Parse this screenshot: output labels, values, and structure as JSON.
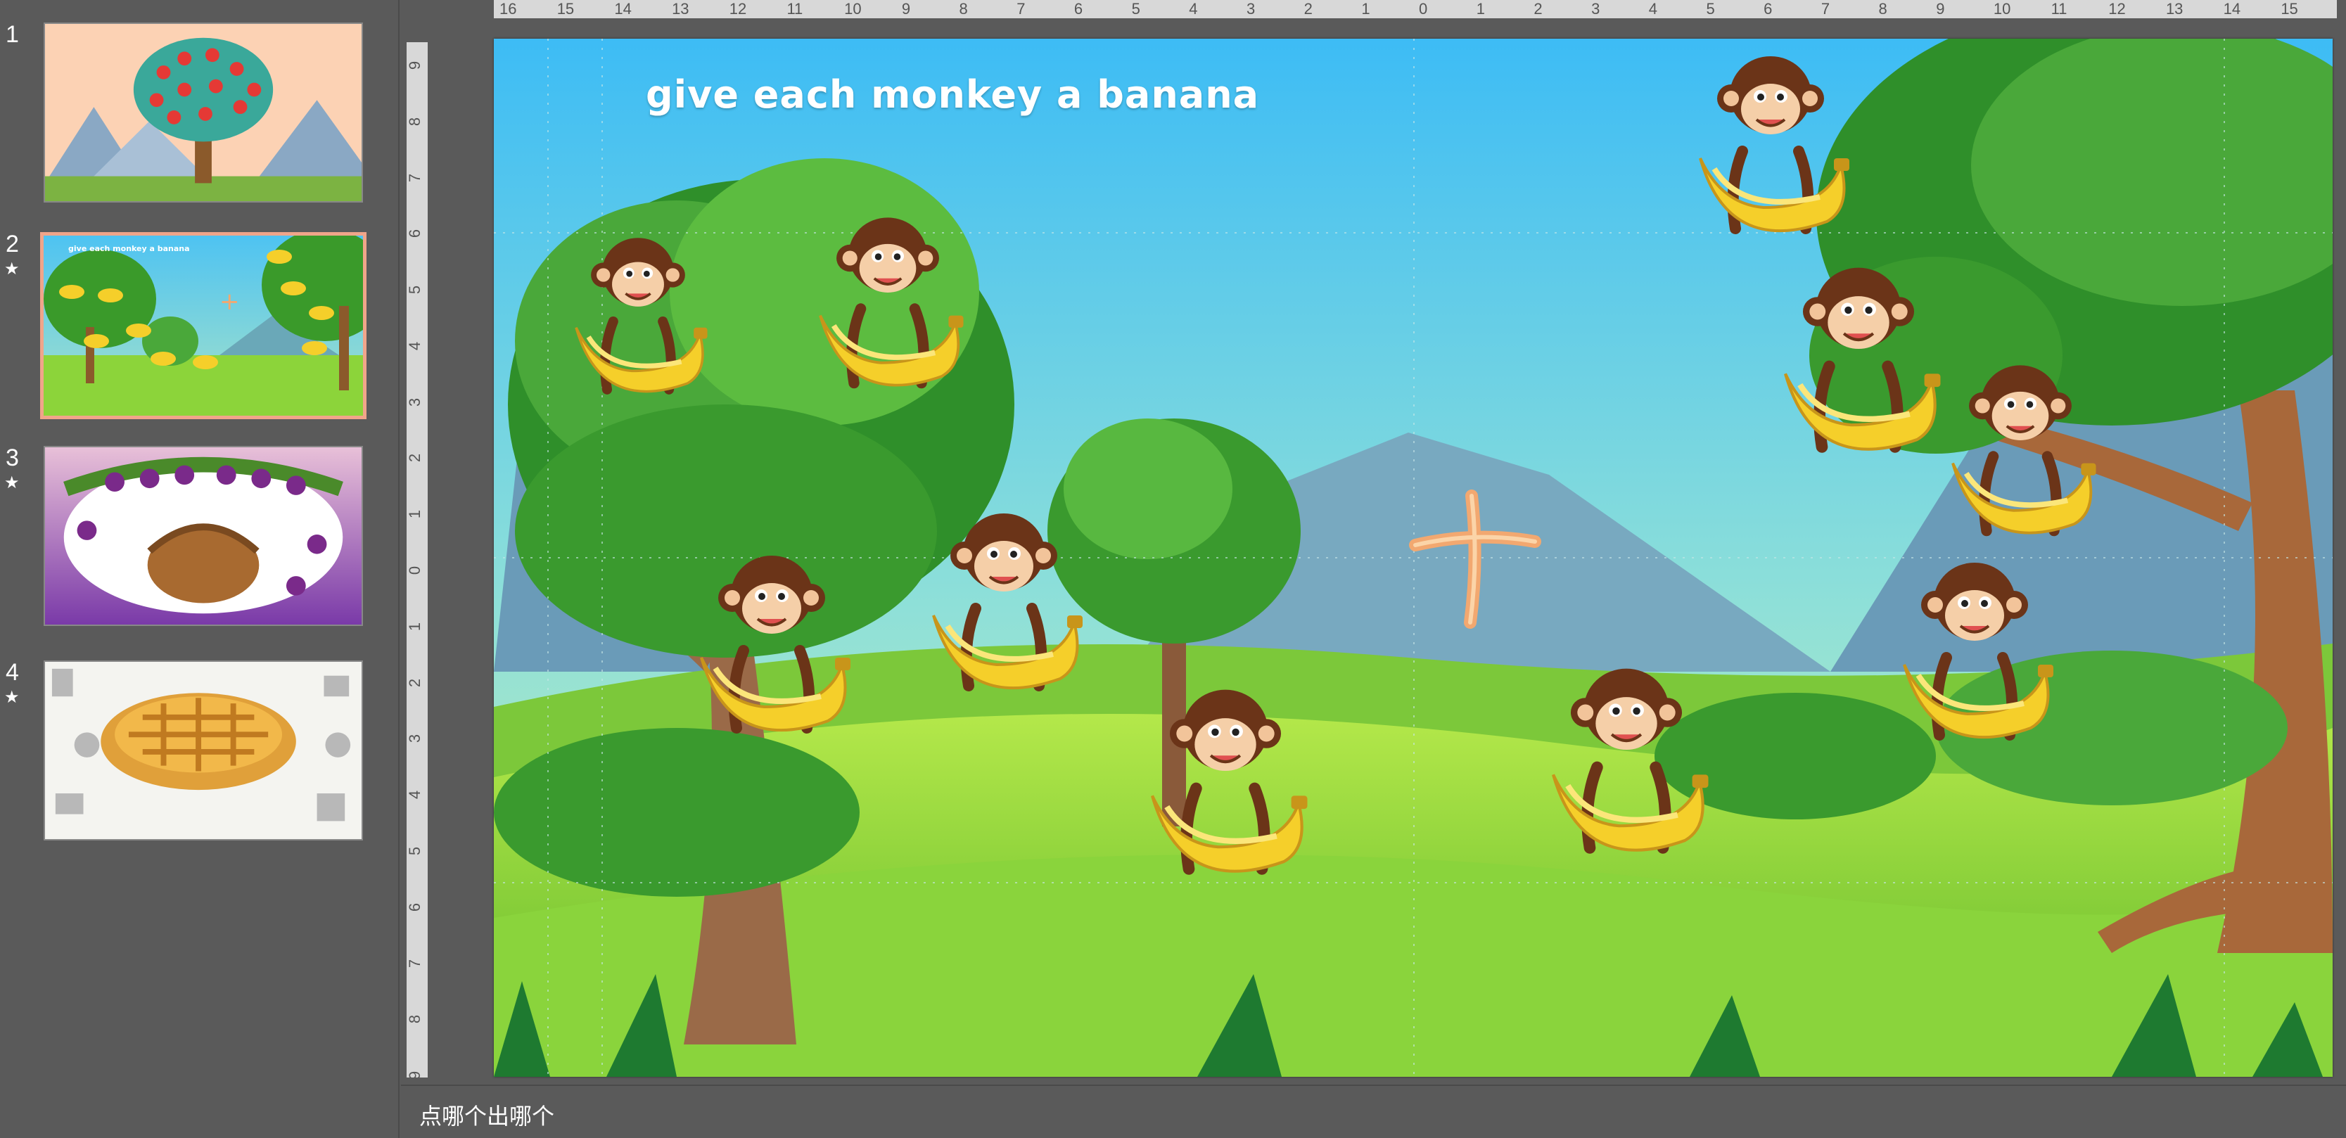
{
  "thumbnails": [
    {
      "num": "1",
      "star": "",
      "selected": false
    },
    {
      "num": "2",
      "star": "★",
      "selected": true
    },
    {
      "num": "3",
      "star": "★",
      "selected": false
    },
    {
      "num": "4",
      "star": "★",
      "selected": false
    }
  ],
  "slide": {
    "title": "give each monkey a banana",
    "plus": "+"
  },
  "notes": {
    "text": "点哪个出哪个"
  },
  "colors": {
    "sky": "#4ec3f2",
    "grass": "#8cd43a",
    "banana": "#f5cf2a",
    "monkey": "#6b3418",
    "ui": "#5a5a5a"
  },
  "icons": [
    "monkey-with-banana-icon",
    "plus-sign-icon"
  ]
}
